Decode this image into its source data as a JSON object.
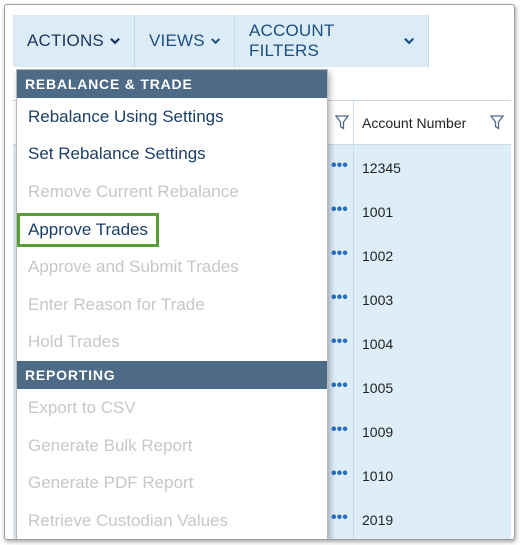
{
  "toolbar": {
    "actions_label": "ACTIONS",
    "views_label": "VIEWS",
    "account_filters_label": "ACCOUNT FILTERS"
  },
  "grid": {
    "account_number_header": "Account Number",
    "rows": [
      {
        "account": "12345"
      },
      {
        "account": "1001"
      },
      {
        "account": "1002"
      },
      {
        "account": "1003"
      },
      {
        "account": "1004"
      },
      {
        "account": "1005"
      },
      {
        "account": "1009"
      },
      {
        "account": "1010"
      },
      {
        "account": "2019"
      }
    ],
    "row_menu_glyph": "•••"
  },
  "menu": {
    "rebalance_section": {
      "title": "REBALANCE & TRADE",
      "items": [
        {
          "label": "Rebalance Using Settings",
          "enabled": true
        },
        {
          "label": "Set Rebalance Settings",
          "enabled": true
        },
        {
          "label": "Remove Current Rebalance",
          "enabled": false
        },
        {
          "label": "Approve Trades",
          "enabled": true,
          "highlighted": true
        },
        {
          "label": "Approve and Submit Trades",
          "enabled": false
        },
        {
          "label": "Enter Reason for Trade",
          "enabled": false
        },
        {
          "label": "Hold Trades",
          "enabled": false
        }
      ]
    },
    "reporting_section": {
      "title": "REPORTING",
      "items": [
        {
          "label": "Export to CSV",
          "enabled": false
        },
        {
          "label": "Generate Bulk Report",
          "enabled": false
        },
        {
          "label": "Generate PDF Report",
          "enabled": false
        },
        {
          "label": "Retrieve Custodian Values",
          "enabled": false
        }
      ]
    }
  },
  "colors": {
    "toolbar_bg": "#dcecf7",
    "section_header_bg": "#4d6a86",
    "highlight_border": "#5a9e3a",
    "grid_bg": "#ddeef9"
  }
}
